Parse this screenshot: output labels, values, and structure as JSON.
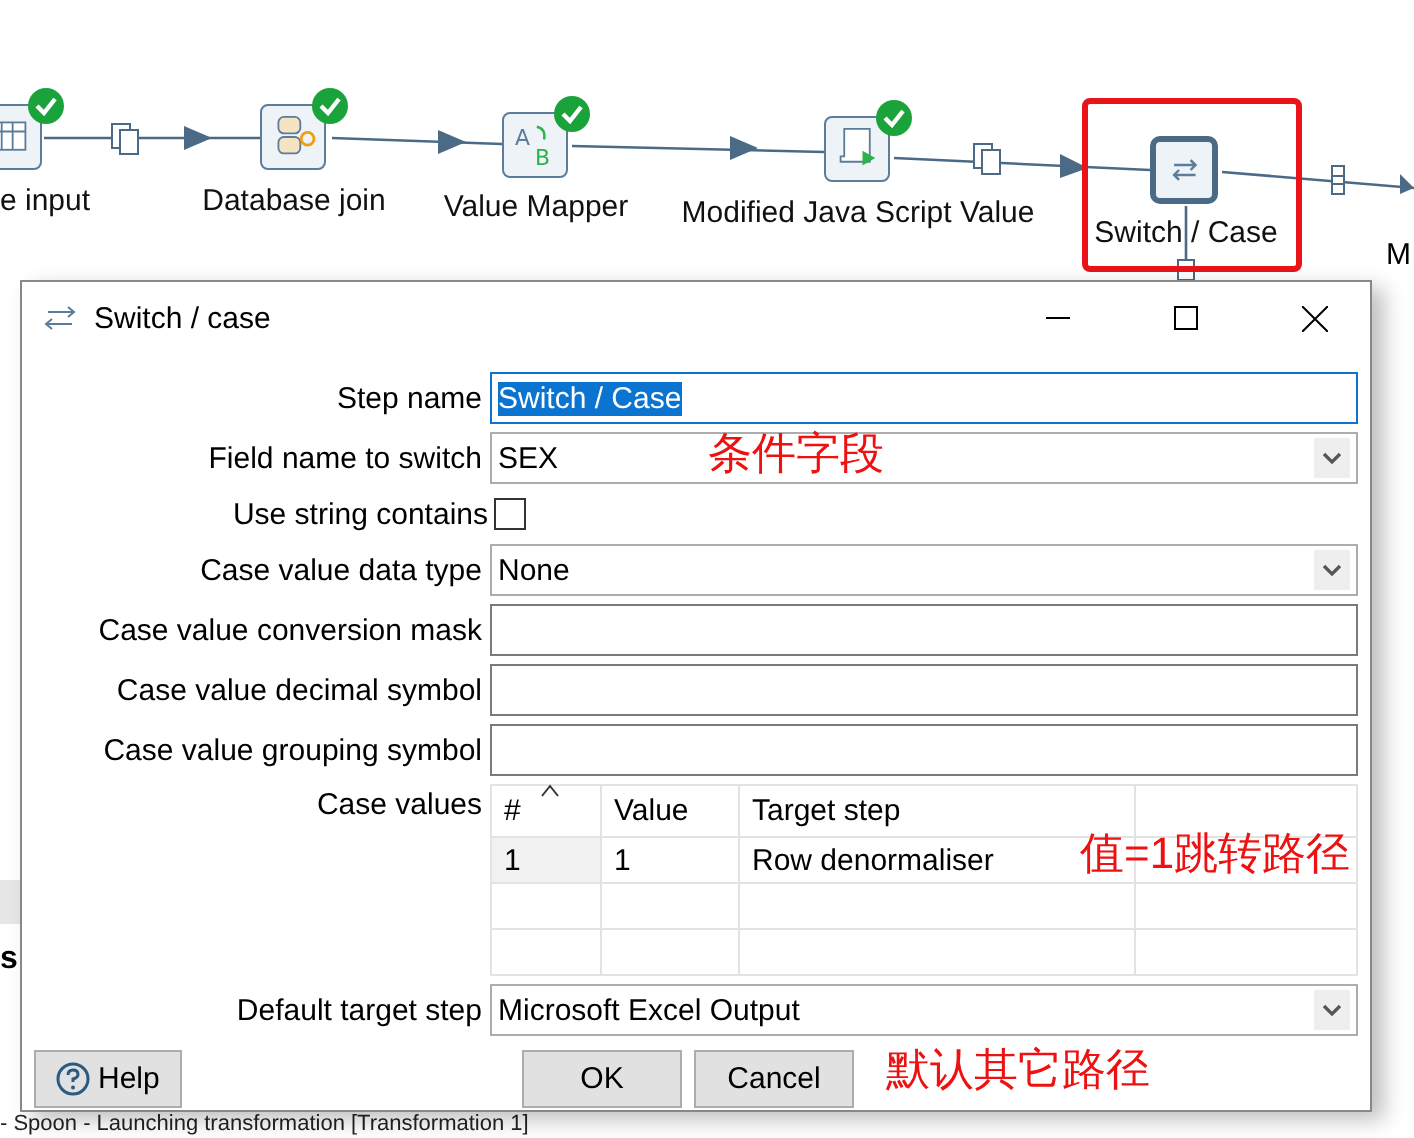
{
  "canvas": {
    "steps": [
      {
        "label": "e input",
        "kind": "table",
        "ok": true,
        "highlighted": false
      },
      {
        "label": "Database join",
        "kind": "dbjoin",
        "ok": true,
        "highlighted": false
      },
      {
        "label": "Value Mapper",
        "kind": "mapper",
        "glyphs": [
          "A",
          "B"
        ],
        "ok": true,
        "highlighted": false
      },
      {
        "label": "Modified Java Script Value",
        "kind": "script",
        "ok": true,
        "highlighted": false
      },
      {
        "label": "Switch / Case",
        "kind": "switch",
        "ok": false,
        "highlighted": true
      }
    ],
    "cut_label": "M"
  },
  "background": {
    "panel_text": "s",
    "log_line": "- Spoon - Launching transformation [Transformation 1]"
  },
  "dialog": {
    "title": "Switch / case",
    "fields": [
      {
        "label": "Step name",
        "kind": "text",
        "value": "Switch / Case",
        "focused": true
      },
      {
        "label": "Field name to switch",
        "kind": "combo",
        "value": "SEX"
      },
      {
        "label": "Use string contains",
        "kind": "checkbox",
        "checked": false
      },
      {
        "label": "Case value data type",
        "kind": "combo",
        "value": "None"
      },
      {
        "label": "Case value conversion mask",
        "kind": "text"
      },
      {
        "label": "Case value decimal symbol",
        "kind": "text"
      },
      {
        "label": "Case value grouping symbol",
        "kind": "text"
      }
    ],
    "case_values": {
      "label": "Case values",
      "columns": [
        "#",
        "Value",
        "Target step"
      ],
      "rows": [
        [
          "1",
          "1",
          "Row denormaliser"
        ]
      ]
    },
    "default_target": {
      "label": "Default target step",
      "value": "Microsoft Excel Output"
    },
    "buttons": [
      {
        "label": "Help",
        "kind": "help"
      },
      {
        "label": "OK",
        "kind": "plain"
      },
      {
        "label": "Cancel",
        "kind": "plain"
      }
    ]
  },
  "annotations": [
    {
      "text": "条件字段"
    },
    {
      "text": "值=1跳转路径"
    },
    {
      "text": "默认其它路径"
    }
  ]
}
